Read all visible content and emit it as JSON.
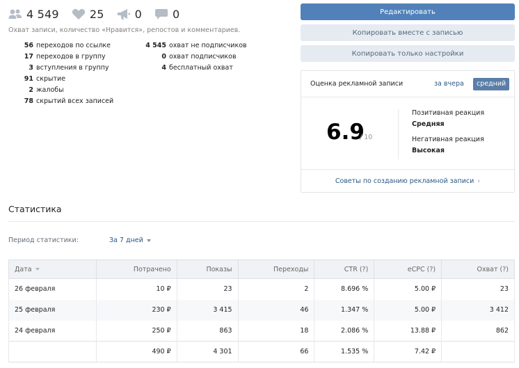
{
  "counters": {
    "reach": "4 549",
    "likes": "25",
    "reposts": "0",
    "comments": "0"
  },
  "subtitle": "Охват записи, количество «Нравится», репостов и комментариев.",
  "metrics_left": [
    {
      "num": "56",
      "label": "переходов по ссылке"
    },
    {
      "num": "17",
      "label": "переходов в группу"
    },
    {
      "num": "3",
      "label": "вступления в группу"
    },
    {
      "num": "91",
      "label": "скрытие"
    },
    {
      "num": "2",
      "label": "жалобы"
    },
    {
      "num": "78",
      "label": "скрытий всех записей"
    }
  ],
  "metrics_right": [
    {
      "num": "4 545",
      "label": "охват не подписчиков"
    },
    {
      "num": "0",
      "label": "охват подписчиков"
    },
    {
      "num": "4",
      "label": "бесплатный охват"
    }
  ],
  "buttons": {
    "edit": "Редактировать",
    "copy_with_post": "Копировать вместе с записью",
    "copy_settings": "Копировать только настройки"
  },
  "rating": {
    "title": "Оценка рекламной записи",
    "tab_yesterday": "за вчера",
    "tab_average": "средний",
    "score": "6.9",
    "score_of": "/ 10",
    "positive_label": "Позитивная реакция",
    "positive_value": "Средняя",
    "negative_label": "Негативная реакция",
    "negative_value": "Высокая",
    "tips_link": "Советы по созданию рекламной записи"
  },
  "stats": {
    "title": "Статистика",
    "period_label": "Период статистики:",
    "period_value": "За 7 дней",
    "columns": [
      "Дата",
      "Потрачено",
      "Показы",
      "Переходы",
      "CTR (?)",
      "eCPC (?)",
      "Охват (?)"
    ],
    "rows": [
      [
        "26 февраля",
        "10 ₽",
        "23",
        "2",
        "8.696 %",
        "5.00 ₽",
        "23"
      ],
      [
        "25 февраля",
        "230 ₽",
        "3 415",
        "46",
        "1.347 %",
        "5.00 ₽",
        "3 412"
      ],
      [
        "24 февраля",
        "250 ₽",
        "863",
        "18",
        "2.086 %",
        "13.88 ₽",
        "862"
      ]
    ],
    "total": [
      "",
      "490 ₽",
      "4 301",
      "66",
      "1.535 %",
      "7.42 ₽",
      ""
    ]
  },
  "colors": {
    "primary_button": "#5181b8",
    "secondary_button": "#e5ebf1",
    "link": "#2a5885",
    "active_tab": "#5b7ea7",
    "icon_gray": "#b4bcc6"
  }
}
